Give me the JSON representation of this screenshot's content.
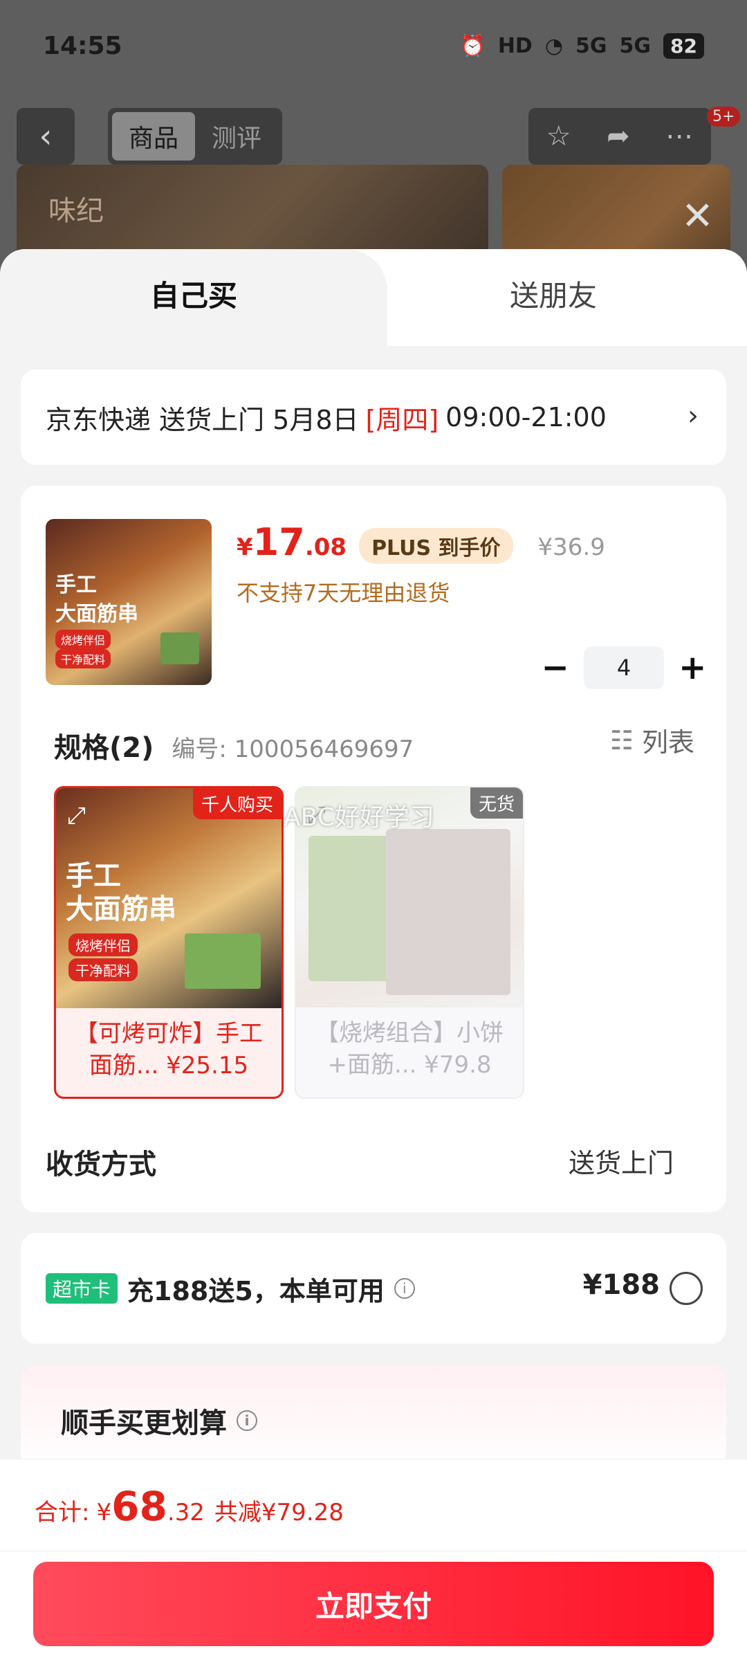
{
  "status_bar": {
    "time": "14:55",
    "icons": [
      "alarm-icon",
      "hd-icon",
      "wifi-icon",
      "signal-5g-icon",
      "signal-5g-icon"
    ],
    "hd": "HD",
    "net1": "5G",
    "net2": "5G",
    "battery": "82"
  },
  "background_page": {
    "tabs": [
      "商品",
      "测评"
    ],
    "badge": "5+"
  },
  "sheet": {
    "tabs": {
      "self": "自己买",
      "friend": "送朋友"
    },
    "delivery": {
      "prefix": "京东快递 送货上门 5月8日",
      "weekday": "[周四]",
      "time": "09:00-21:00"
    },
    "product": {
      "price_currency": "¥",
      "price_int": "17",
      "price_dec": ".08",
      "plus_badge": "PLUS 到手价",
      "original_price": "¥36.9",
      "return_policy": "不支持7天无理由退货",
      "quantity": "4",
      "thumb_text1": "手工",
      "thumb_text2": "大面筋串",
      "thumb_tag1": "烧烤伴侣",
      "thumb_tag2": "干净配料"
    },
    "spec": {
      "title": "规格(2)",
      "code": "编号: 100056469697",
      "list_label": "列表",
      "options": [
        {
          "corner": "千人购买",
          "img_text1": "手工",
          "img_text2": "大面筋串",
          "tag1": "烧烤伴侣",
          "tag2": "干净配料",
          "line1": "【可烤可炸】手工",
          "line2": "面筋... ¥25.15"
        },
        {
          "corner": "无货",
          "line1": "【烧烤组合】小饼",
          "line2": "+面筋... ¥79.8"
        }
      ],
      "watermark": "ABC好好学习"
    },
    "shipping": {
      "label": "收货方式",
      "value": "送货上门"
    },
    "promo": {
      "badge": "超市卡",
      "text": "充188送5，本单可用",
      "price": "¥188"
    },
    "extra": {
      "title": "顺手买更划算"
    }
  },
  "bottom_bar": {
    "total_label": "合计:",
    "currency": "¥",
    "total_int": "68",
    "total_dec": ".32",
    "discount": "共减¥79.28",
    "pay_button": "立即支付"
  },
  "colors": {
    "accent_red": "#e2231a",
    "plus_bg": "#fde8cf",
    "promo_green": "#1fbf7a",
    "pay_gradient_start": "#ff4b5c",
    "pay_gradient_end": "#ff1327"
  }
}
